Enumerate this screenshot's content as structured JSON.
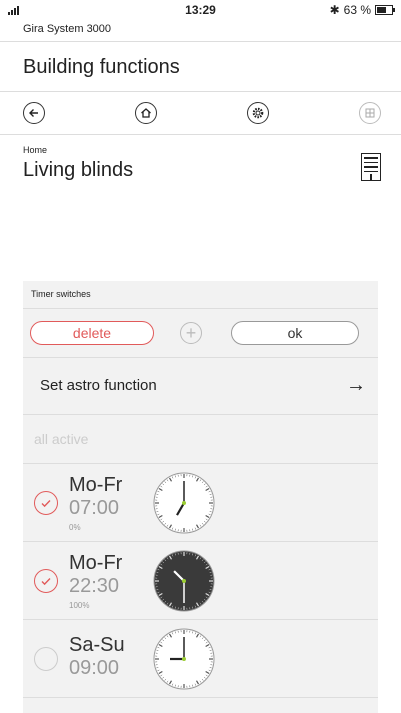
{
  "status": {
    "time": "13:29",
    "battery": "63 %",
    "battery_level": 0.63
  },
  "system_name": "Gira System 3000",
  "section_title": "Building functions",
  "toolbar": {
    "back_icon": "back-arrow-icon",
    "home_icon": "home-icon",
    "settings_icon": "gear-icon",
    "grid_icon": "grid-icon"
  },
  "room": {
    "location": "Home",
    "title": "Living blinds"
  },
  "panel": {
    "header": "Timer switches",
    "delete_label": "delete",
    "add_label": "+",
    "ok_label": "ok",
    "astro_label": "Set astro function",
    "astro_arrow": "→",
    "all_active_label": "all active"
  },
  "timers": [
    {
      "days": "Mo-Fr",
      "time": "07:00",
      "position": "0%",
      "active": true,
      "clock_theme": "light",
      "hour": 7,
      "minute": 0
    },
    {
      "days": "Mo-Fr",
      "time": "22:30",
      "position": "100%",
      "active": true,
      "clock_theme": "dark",
      "hour": 22,
      "minute": 30
    },
    {
      "days": "Sa-Su",
      "time": "09:00",
      "position": "",
      "active": false,
      "clock_theme": "light",
      "hour": 9,
      "minute": 0
    }
  ],
  "colors": {
    "accent_red": "#e15a5a",
    "clock_hand_green": "#9acd32",
    "panel_bg": "#f2f2f2"
  }
}
